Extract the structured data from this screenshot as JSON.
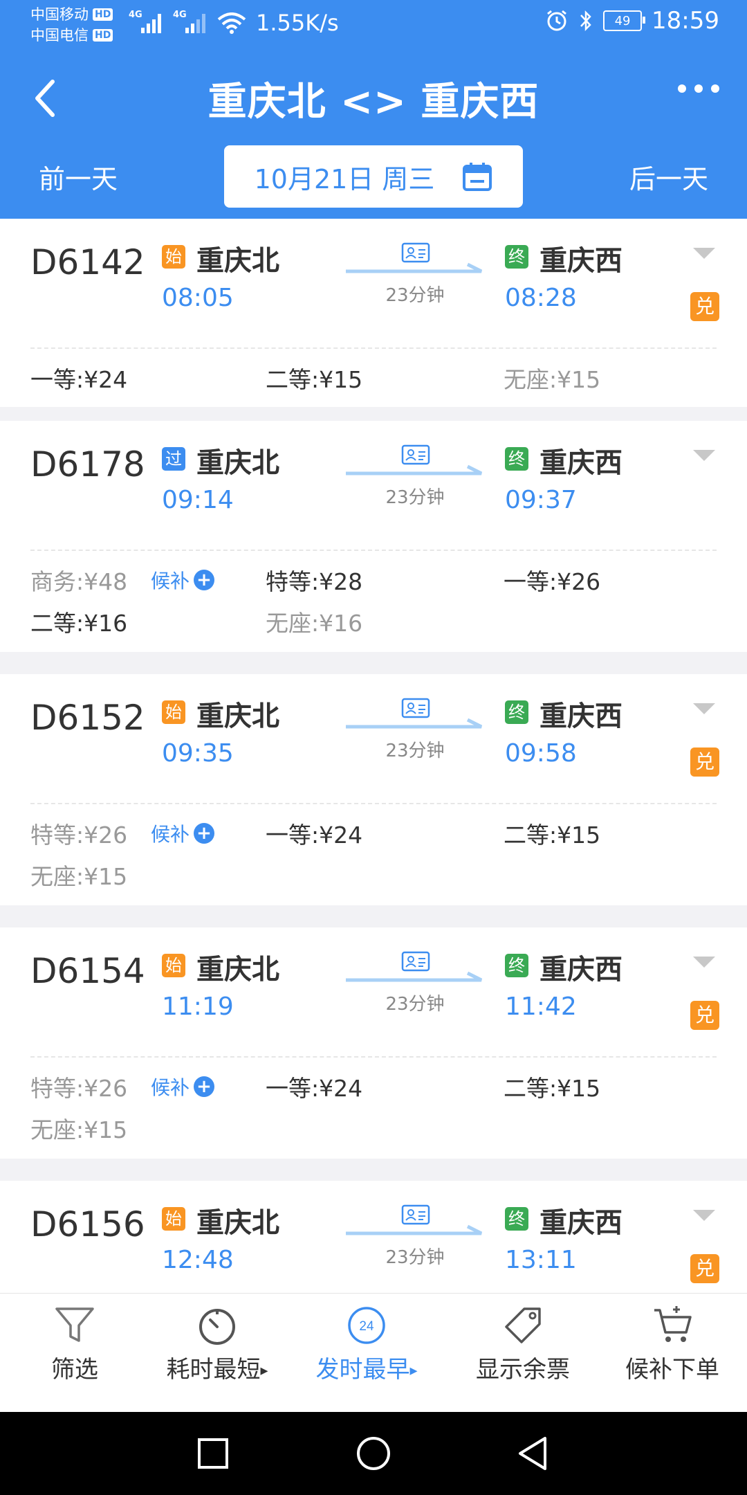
{
  "status": {
    "carrier1": "中国移动",
    "carrier2": "中国电信",
    "hd": "HD",
    "net_type": "4G",
    "speed": "1.55K/s",
    "battery": "49",
    "time": "18:59"
  },
  "header": {
    "title": "重庆北 <> 重庆西",
    "prev_day": "前一天",
    "next_day": "后一天",
    "date": "10月21日 周三"
  },
  "trains": [
    {
      "number": "D6142",
      "from_badge": "始",
      "from": "重庆北",
      "depart": "08:05",
      "duration": "23分钟",
      "to_badge": "终",
      "to": "重庆西",
      "arrive": "08:28",
      "dui": "兑",
      "seats": [
        {
          "label": "一等:",
          "price": "¥24"
        },
        {
          "label": "二等:",
          "price": "¥15"
        },
        {
          "label": "无座:",
          "price": "¥15"
        }
      ]
    },
    {
      "number": "D6178",
      "from_badge": "过",
      "from": "重庆北",
      "depart": "09:14",
      "duration": "23分钟",
      "to_badge": "终",
      "to": "重庆西",
      "arrive": "09:37",
      "seats": [
        {
          "label": "商务:",
          "price": "¥48",
          "houbu": "候补"
        },
        {
          "label": "特等:",
          "price": "¥28"
        },
        {
          "label": "一等:",
          "price": "¥26"
        },
        {
          "label": "二等:",
          "price": "¥16"
        },
        {
          "label": "无座:",
          "price": "¥16"
        }
      ]
    },
    {
      "number": "D6152",
      "from_badge": "始",
      "from": "重庆北",
      "depart": "09:35",
      "duration": "23分钟",
      "to_badge": "终",
      "to": "重庆西",
      "arrive": "09:58",
      "dui": "兑",
      "seats": [
        {
          "label": "特等:",
          "price": "¥26",
          "houbu": "候补"
        },
        {
          "label": "一等:",
          "price": "¥24"
        },
        {
          "label": "二等:",
          "price": "¥15"
        },
        {
          "label": "无座:",
          "price": "¥15"
        }
      ]
    },
    {
      "number": "D6154",
      "from_badge": "始",
      "from": "重庆北",
      "depart": "11:19",
      "duration": "23分钟",
      "to_badge": "终",
      "to": "重庆西",
      "arrive": "11:42",
      "dui": "兑",
      "seats": [
        {
          "label": "特等:",
          "price": "¥26",
          "houbu": "候补"
        },
        {
          "label": "一等:",
          "price": "¥24"
        },
        {
          "label": "二等:",
          "price": "¥15"
        },
        {
          "label": "无座:",
          "price": "¥15"
        }
      ]
    },
    {
      "number": "D6156",
      "from_badge": "始",
      "from": "重庆北",
      "depart": "12:48",
      "duration": "23分钟",
      "to_badge": "终",
      "to": "重庆西",
      "arrive": "13:11",
      "dui": "兑",
      "seats": []
    }
  ],
  "toolbar": {
    "filter": "筛选",
    "shortest": "耗时最短",
    "earliest": "发时最早",
    "earliest_icon_text": "24",
    "remaining": "显示余票",
    "waitlist": "候补下单"
  },
  "colors": {
    "primary": "#3c8df0",
    "orange": "#f99523",
    "green": "#3aaa54"
  }
}
